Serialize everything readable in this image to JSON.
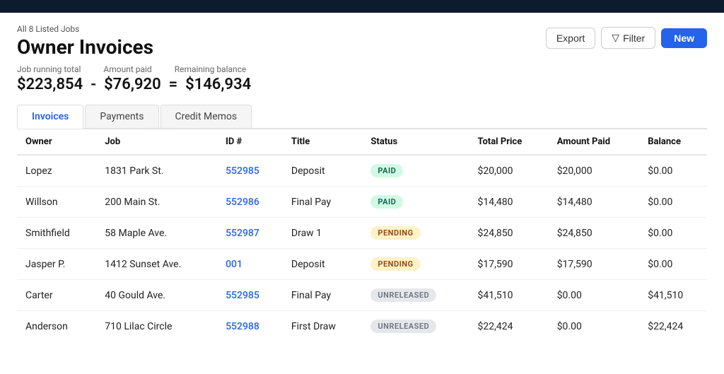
{
  "topbar": {},
  "header": {
    "listed_jobs": "All 8 Listed Jobs",
    "title": "Owner Invoices",
    "export_label": "Export",
    "filter_label": "Filter",
    "new_label": "New"
  },
  "summary": {
    "label_running": "Job running total",
    "label_paid": "Amount paid",
    "label_remaining": "Remaining balance",
    "running_total": "$223,854",
    "separator1": "-",
    "amount_paid": "$76,920",
    "equals": "=",
    "remaining": "$146,934"
  },
  "tabs": [
    {
      "id": "invoices",
      "label": "Invoices",
      "active": true
    },
    {
      "id": "payments",
      "label": "Payments",
      "active": false
    },
    {
      "id": "credit-memos",
      "label": "Credit Memos",
      "active": false
    }
  ],
  "table": {
    "columns": [
      {
        "key": "owner",
        "label": "Owner"
      },
      {
        "key": "job",
        "label": "Job"
      },
      {
        "key": "id",
        "label": "ID #"
      },
      {
        "key": "title",
        "label": "Title"
      },
      {
        "key": "status",
        "label": "Status"
      },
      {
        "key": "total_price",
        "label": "Total Price"
      },
      {
        "key": "amount_paid",
        "label": "Amount Paid"
      },
      {
        "key": "balance",
        "label": "Balance"
      }
    ],
    "rows": [
      {
        "owner": "Lopez",
        "job": "1831 Park St.",
        "id": "552985",
        "title": "Deposit",
        "status": "PAID",
        "status_type": "paid",
        "total_price": "$20,000",
        "amount_paid": "$20,000",
        "balance": "$0.00"
      },
      {
        "owner": "Willson",
        "job": "200 Main St.",
        "id": "552986",
        "title": "Final Pay",
        "status": "PAID",
        "status_type": "paid",
        "total_price": "$14,480",
        "amount_paid": "$14,480",
        "balance": "$0.00"
      },
      {
        "owner": "Smithfield",
        "job": "58 Maple Ave.",
        "id": "552987",
        "title": "Draw 1",
        "status": "PENDING",
        "status_type": "pending",
        "total_price": "$24,850",
        "amount_paid": "$24,850",
        "balance": "$0.00"
      },
      {
        "owner": "Jasper P.",
        "job": "1412 Sunset Ave.",
        "id": "001",
        "title": "Deposit",
        "status": "PENDING",
        "status_type": "pending",
        "total_price": "$17,590",
        "amount_paid": "$17,590",
        "balance": "$0.00"
      },
      {
        "owner": "Carter",
        "job": "40 Gould Ave.",
        "id": "552985",
        "title": "Final Pay",
        "status": "UNRELEASED",
        "status_type": "unreleased",
        "total_price": "$41,510",
        "amount_paid": "$0.00",
        "balance": "$41,510"
      },
      {
        "owner": "Anderson",
        "job": "710 Lilac Circle",
        "id": "552988",
        "title": "First Draw",
        "status": "UNRELEASED",
        "status_type": "unreleased",
        "total_price": "$22,424",
        "amount_paid": "$0.00",
        "balance": "$22,424"
      }
    ]
  }
}
